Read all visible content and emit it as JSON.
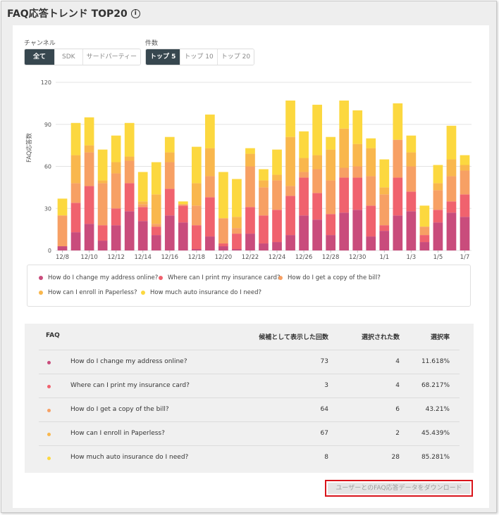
{
  "header": {
    "title": "FAQ応答トレンド TOP20",
    "info_icon": "i"
  },
  "channel": {
    "label": "チャンネル",
    "options": [
      "全て",
      "SDK",
      "サードパーティー"
    ],
    "selected": "全て"
  },
  "count": {
    "label": "件数",
    "options": [
      "トップ 5",
      "トップ 10",
      "トップ 20"
    ],
    "selected": "トップ 5"
  },
  "colors": {
    "series1": "#c94c7c",
    "series2": "#f0626e",
    "series3": "#f7a064",
    "series4": "#f9b74d",
    "series5": "#fcd83f"
  },
  "chart_data": {
    "type": "bar",
    "stacked": true,
    "ylabel": "FAQ応答数",
    "ylim": [
      0,
      120
    ],
    "yticks": [
      "0",
      "30",
      "60",
      "90",
      "120"
    ],
    "categories": [
      "12/8",
      "12/9",
      "12/10",
      "12/11",
      "12/12",
      "12/13",
      "12/14",
      "12/15",
      "12/16",
      "12/17",
      "12/18",
      "12/19",
      "12/20",
      "12/21",
      "12/22",
      "12/23",
      "12/24",
      "12/25",
      "12/26",
      "12/27",
      "12/28",
      "12/29",
      "12/30",
      "12/31",
      "1/1",
      "1/2",
      "1/3",
      "1/4",
      "1/5",
      "1/6",
      "1/7"
    ],
    "xtick_labels": [
      "12/8",
      "12/10",
      "12/12",
      "12/14",
      "12/16",
      "12/18",
      "12/20",
      "12/22",
      "12/24",
      "12/26",
      "12/28",
      "12/30",
      "1/1",
      "1/3",
      "1/5",
      "1/7"
    ],
    "series": [
      {
        "name": "How do I change my address online?",
        "values": [
          3,
          13,
          19,
          7,
          18,
          28,
          21,
          11,
          25,
          20,
          1,
          10,
          3,
          1,
          12,
          5,
          6,
          11,
          25,
          22,
          11,
          27,
          29,
          10,
          14,
          25,
          28,
          6,
          20,
          27,
          24
        ]
      },
      {
        "name": "Where can I print my insurance card?",
        "values": [
          0,
          21,
          27,
          11,
          12,
          20,
          10,
          6,
          19,
          12,
          17,
          28,
          2,
          11,
          19,
          20,
          23,
          28,
          27,
          19,
          15,
          25,
          23,
          22,
          4,
          27,
          14,
          5,
          9,
          8,
          16
        ]
      },
      {
        "name": "How do I get a copy of the bill?",
        "values": [
          22,
          14,
          24,
          30,
          25,
          16,
          2,
          2,
          19,
          1,
          14,
          15,
          18,
          4,
          29,
          20,
          21,
          7,
          4,
          17,
          24,
          7,
          8,
          21,
          22,
          27,
          18,
          6,
          14,
          18,
          17
        ]
      },
      {
        "name": "How can I enroll in Paperless?",
        "values": [
          0,
          20,
          5,
          2,
          8,
          3,
          2,
          21,
          7,
          0,
          16,
          20,
          0,
          8,
          9,
          5,
          4,
          35,
          10,
          10,
          22,
          28,
          16,
          20,
          5,
          0,
          10,
          0,
          5,
          12,
          4
        ]
      },
      {
        "name": "How much auto insurance do I need?",
        "values": [
          12,
          23,
          20,
          22,
          19,
          24,
          21,
          23,
          11,
          2,
          26,
          24,
          33,
          27,
          4,
          8,
          18,
          26,
          19,
          36,
          9,
          20,
          24,
          7,
          20,
          26,
          12,
          15,
          13,
          24,
          7
        ]
      }
    ]
  },
  "table": {
    "headers": {
      "faq": "FAQ",
      "shown": "候補として表示した回数",
      "selected": "選択された数",
      "rate": "選択率"
    },
    "rows": [
      {
        "faq": "How do I change my address online?",
        "shown": "73",
        "selected": "4",
        "rate": "11.618%"
      },
      {
        "faq": "Where can I print my insurance card?",
        "shown": "3",
        "selected": "4",
        "rate": "68.217%"
      },
      {
        "faq": "How do I get a copy of the bill?",
        "shown": "64",
        "selected": "6",
        "rate": "43.21%"
      },
      {
        "faq": "How can I enroll in Paperless?",
        "shown": "67",
        "selected": "2",
        "rate": "45.439%"
      },
      {
        "faq": "How much auto insurance do I need?",
        "shown": "8",
        "selected": "28",
        "rate": "85.281%"
      }
    ]
  },
  "download_label": "ユーザーとのFAQ応答データをダウンロード"
}
